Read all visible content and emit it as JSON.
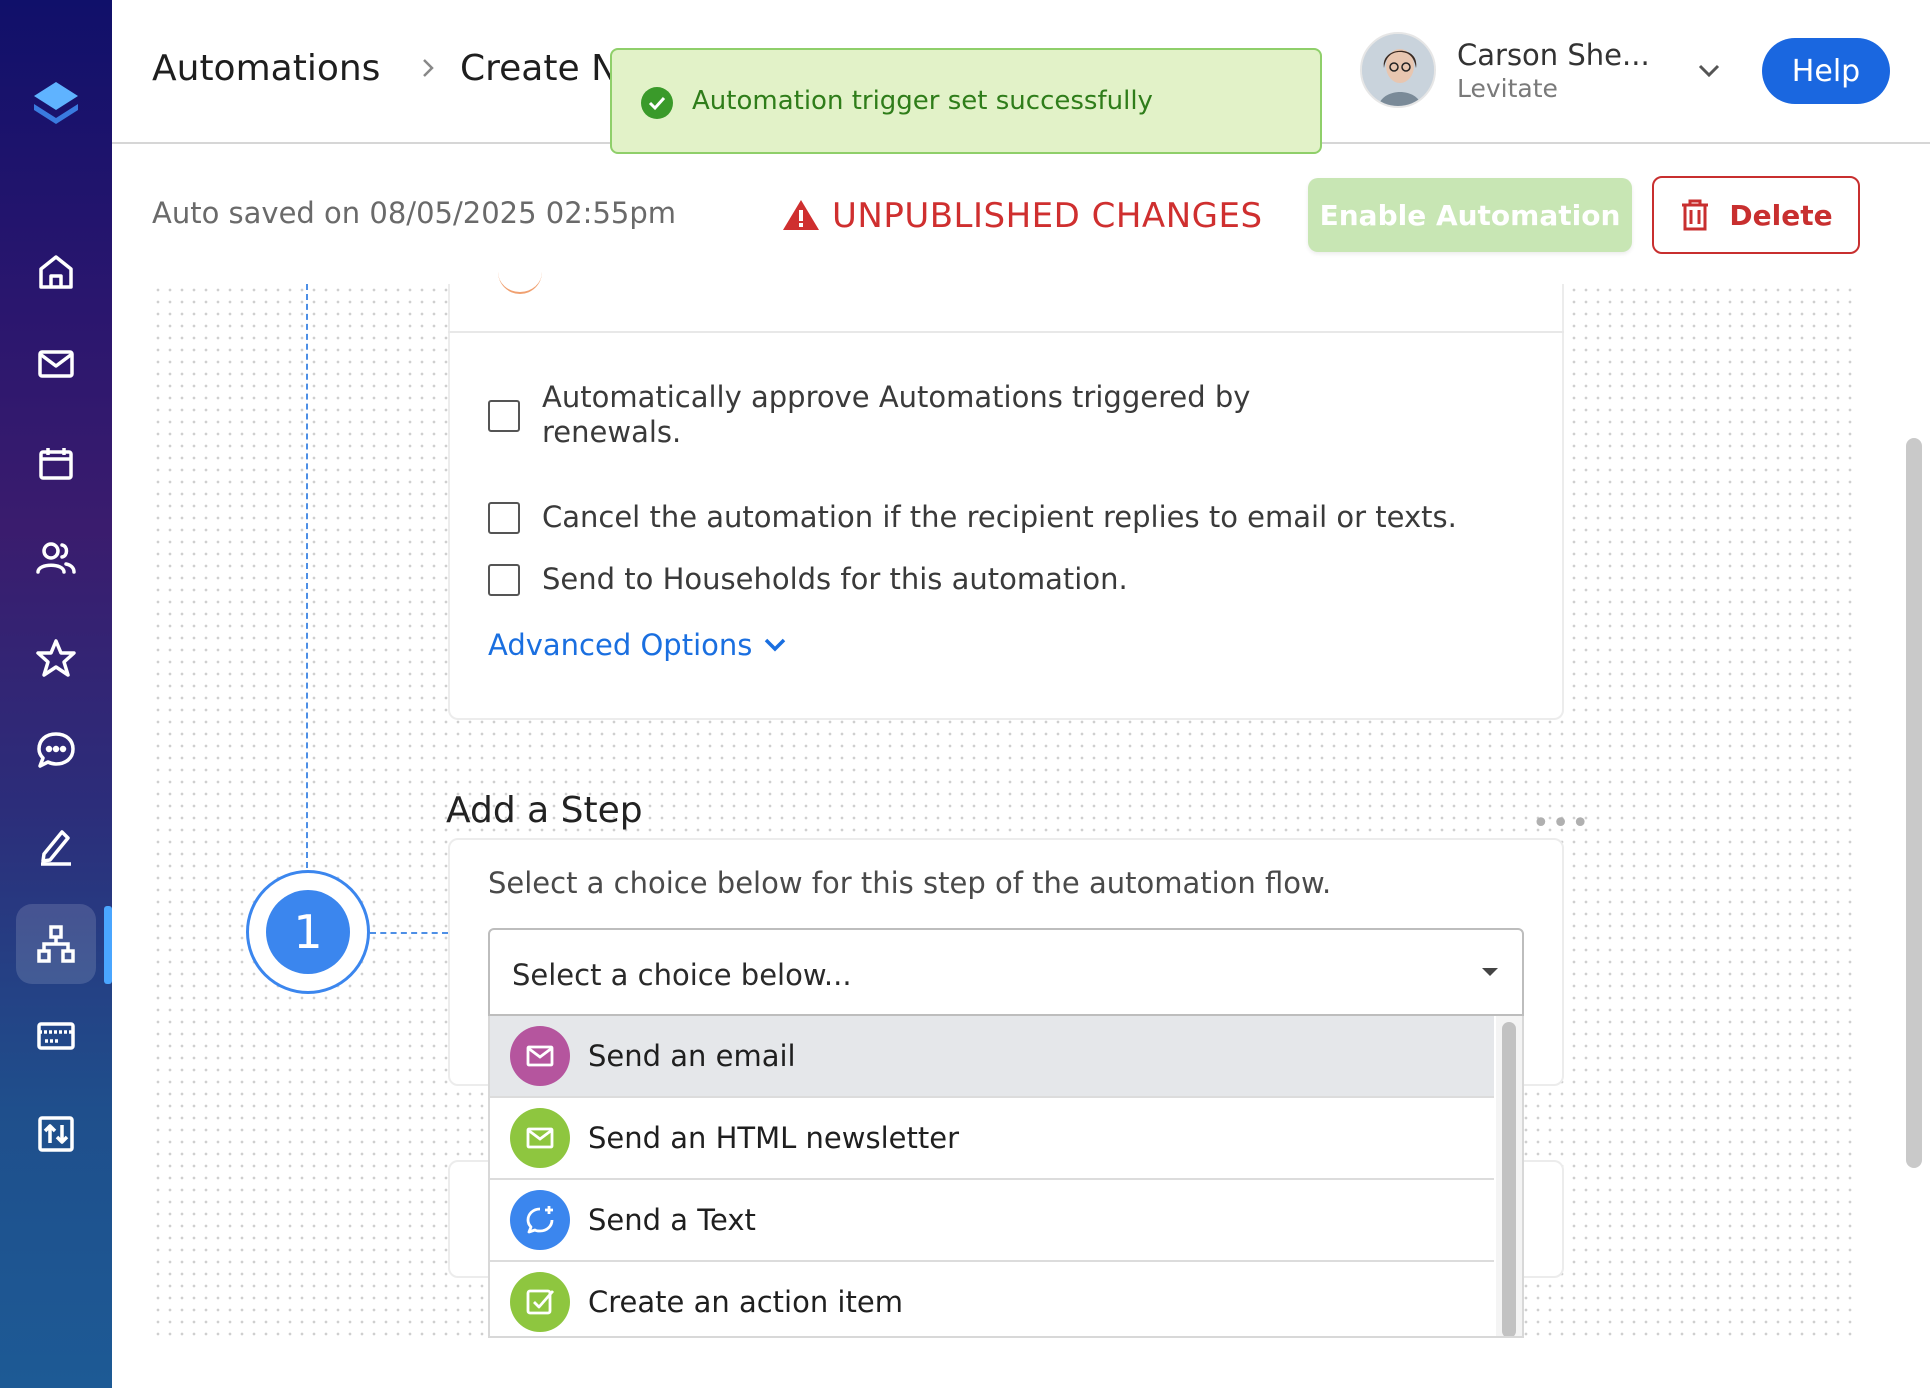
{
  "header": {
    "breadcrumb_root": "Automations",
    "breadcrumb_current": "Create N",
    "user_name": "Carson She...",
    "user_org": "Levitate",
    "help_label": "Help"
  },
  "toast": {
    "message": "Automation trigger set successfully"
  },
  "toolbar": {
    "autosave": "Auto saved on 08/05/2025 02:55pm",
    "status": "UNPUBLISHED CHANGES",
    "enable_label": "Enable Automation",
    "delete_label": "Delete"
  },
  "options": {
    "checkboxes": [
      "Automatically approve Automations triggered by renewals.",
      "Cancel the automation if the recipient replies to email or texts.",
      "Send to Households for this automation."
    ],
    "advanced_label": "Advanced Options"
  },
  "step": {
    "title": "Add a Step",
    "number": "1",
    "description": "Select a choice below for this step of the automation flow.",
    "select_placeholder": "Select a choice below...",
    "choices": [
      {
        "label": "Send an email",
        "icon": "mail-icon",
        "color": "#b5559e"
      },
      {
        "label": "Send an HTML newsletter",
        "icon": "mail-icon",
        "color": "#8ec63f"
      },
      {
        "label": "Send a Text",
        "icon": "chat-plus-icon",
        "color": "#3b86ee"
      },
      {
        "label": "Create an action item",
        "icon": "checkbox-icon",
        "color": "#8ec63f"
      }
    ]
  },
  "colors": {
    "accent": "#1a67e0",
    "danger": "#c82f2f",
    "success": "#2f7d1a"
  }
}
